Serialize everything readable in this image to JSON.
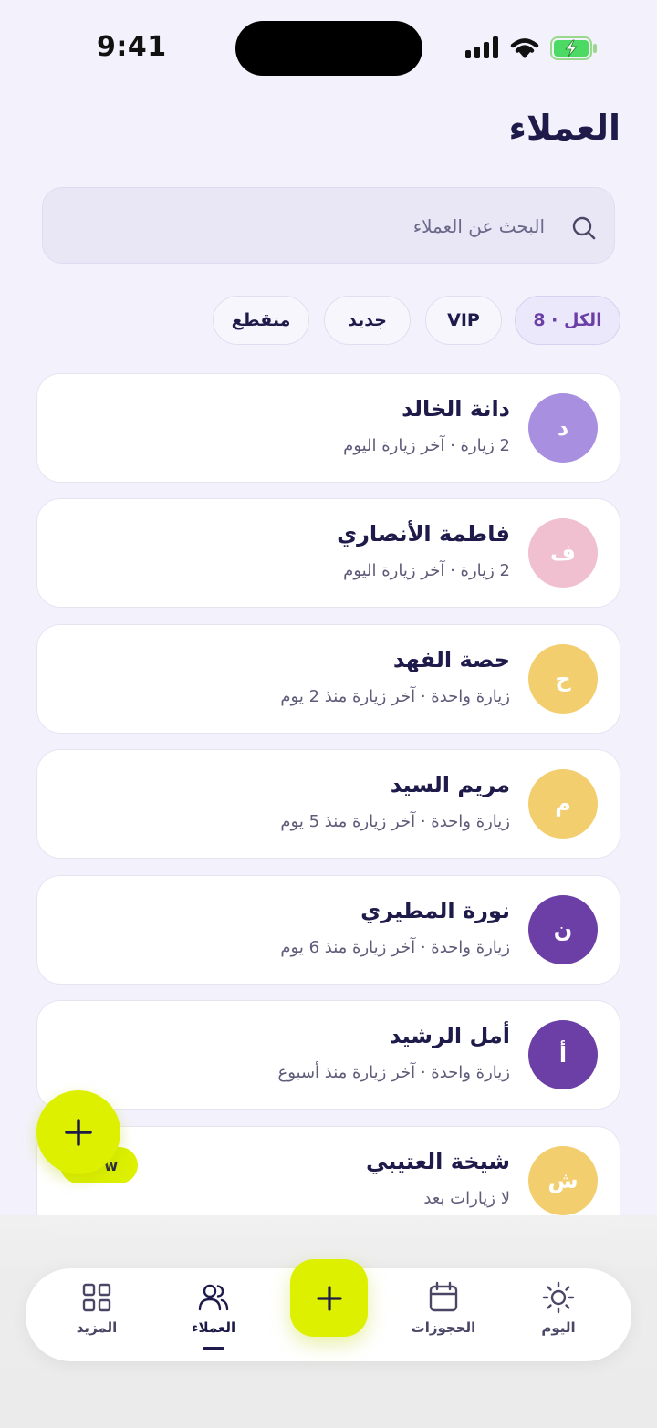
{
  "status_bar": {
    "time": "9:41"
  },
  "header": {
    "title": "العملاء"
  },
  "search": {
    "placeholder": "البحث عن العملاء"
  },
  "filters": [
    {
      "label": "الكل · 8",
      "active": true
    },
    {
      "label": "VIP",
      "active": false
    },
    {
      "label": "جديد",
      "active": false
    },
    {
      "label": "منقطع",
      "active": false
    }
  ],
  "clients": [
    {
      "initial": "د",
      "name": "دانة الخالد",
      "meta": "2 زيارة · آخر زيارة اليوم",
      "color": "#a98fe0"
    },
    {
      "initial": "ف",
      "name": "فاطمة الأنصاري",
      "meta": "2 زيارة · آخر زيارة اليوم",
      "color": "#f0bfd0"
    },
    {
      "initial": "ح",
      "name": "حصة الفهد",
      "meta": "زيارة واحدة · آخر زيارة منذ 2 يوم",
      "color": "#f2ce6e"
    },
    {
      "initial": "م",
      "name": "مريم السيد",
      "meta": "زيارة واحدة · آخر زيارة منذ 5 يوم",
      "color": "#f2ce6e"
    },
    {
      "initial": "ن",
      "name": "نورة المطيري",
      "meta": "زيارة واحدة · آخر زيارة منذ 6 يوم",
      "color": "#6b3fa6"
    },
    {
      "initial": "أ",
      "name": "أمل الرشيد",
      "meta": "زيارة واحدة · آخر زيارة منذ أسبوع",
      "color": "#6b3fa6"
    },
    {
      "initial": "ش",
      "name": "شيخة العتيبي",
      "meta": "لا زيارات بعد",
      "color": "#f2ce6e"
    }
  ],
  "fab": {
    "icon": "plus-icon",
    "label": "w"
  },
  "tabs": [
    {
      "label": "اليوم",
      "icon": "sun-icon",
      "active": false
    },
    {
      "label": "الحجوزات",
      "icon": "calendar-icon",
      "active": false
    },
    {
      "label": "العملاء",
      "icon": "users-icon",
      "active": true
    },
    {
      "label": "المزيد",
      "icon": "grid-icon",
      "active": false
    }
  ],
  "colors": {
    "accent": "#dcf000",
    "primary_text": "#1e1b4b",
    "purple": "#6b3fa6",
    "background": "#f3f2fc"
  }
}
